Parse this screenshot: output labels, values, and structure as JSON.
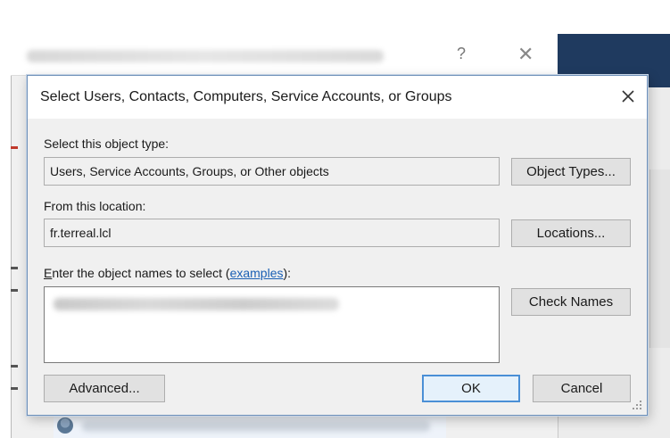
{
  "dialog": {
    "title": "Select Users, Contacts, Computers, Service Accounts, or Groups",
    "object_type_label": "Select this object type:",
    "object_type_value": "Users, Service Accounts, Groups, or Other objects",
    "object_types_button": "Object Types...",
    "location_label": "From this location:",
    "location_value": "fr.terreal.lcl",
    "locations_button": "Locations...",
    "names_label_prefix_accel": "E",
    "names_label_prefix_rest": "nter the object names to select (",
    "names_label_link": "examples",
    "names_label_suffix": "):",
    "check_names_button": "Check Names",
    "advanced_button": "Advanced...",
    "ok_button": "OK",
    "cancel_button": "Cancel"
  },
  "background_window": {
    "help_glyph": "?",
    "close_glyph": "✕"
  },
  "icons": {
    "dialog_close": "close-icon",
    "resize_grip": "resize-grip-icon"
  },
  "colors": {
    "dialog_border": "#6d8fb8",
    "primary_button_border": "#4a8fd6",
    "link": "#1a5fb4",
    "dialog_background": "#f0f0f0"
  }
}
